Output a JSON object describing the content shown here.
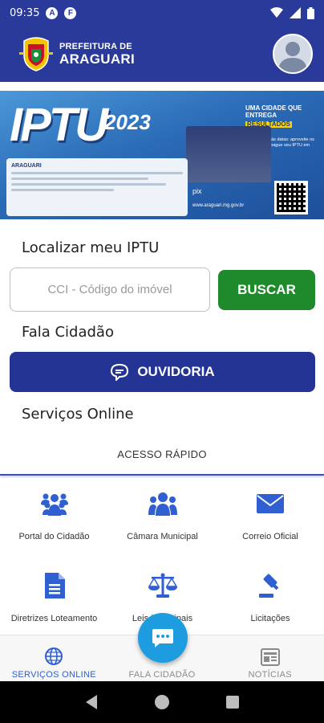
{
  "status_bar": {
    "time": "09:35",
    "icons": [
      "a-icon",
      "f-icon",
      "wifi-icon",
      "signal-icon",
      "battery-icon"
    ]
  },
  "header": {
    "brand_line1": "PREFEITURA DE",
    "brand_line2": "ARAGUARI",
    "background": "#2a3a9a"
  },
  "banner": {
    "title": "IPTU",
    "year": "2023",
    "tagline_1": "UMA CIDADE QUE ENTREGA",
    "tagline_2": "RESULTADOS",
    "description": "Fique atento às datas: aproveite os descontos e pague seu IPTU em dia.",
    "card_org": "ARAGUARI",
    "pix": "pix",
    "url": "www.araguari.mg.gov.br"
  },
  "localizar": {
    "label": "Localizar meu IPTU",
    "placeholder": "CCI - Código do imóvel",
    "value": "",
    "button_label": "BUSCAR",
    "button_color": "#1f8a2b"
  },
  "fala_cidadao": {
    "label": "Fala Cidadão",
    "button_label": "OUVIDORIA",
    "button_color": "#233494"
  },
  "servicos": {
    "label": "Serviços Online"
  },
  "acesso_rapido": {
    "title": "ACESSO RÁPIDO",
    "items": [
      {
        "label": "Portal do Cidadão",
        "icon": "people-group-icon"
      },
      {
        "label": "Câmara Municipal",
        "icon": "users-icon"
      },
      {
        "label": "Correio Oficial",
        "icon": "envelope-icon"
      },
      {
        "label": "Diretrizes Loteamento",
        "icon": "document-icon"
      },
      {
        "label": "Leis Municipais",
        "icon": "scales-icon"
      },
      {
        "label": "Licitações",
        "icon": "gavel-icon"
      }
    ],
    "icon_color": "#2f5fd0"
  },
  "bottom_nav": {
    "items": [
      {
        "label": "SERVIÇOS ONLINE",
        "icon": "globe-icon",
        "active": true
      },
      {
        "label": "FALA CIDADÃO",
        "icon": "chat-icon",
        "active": false
      },
      {
        "label": "NOTÍCIAS",
        "icon": "news-icon",
        "active": false
      }
    ],
    "active_color": "#2f5fd0"
  },
  "fab": {
    "icon": "chat-bubble-icon",
    "color": "#1e9ce0"
  }
}
